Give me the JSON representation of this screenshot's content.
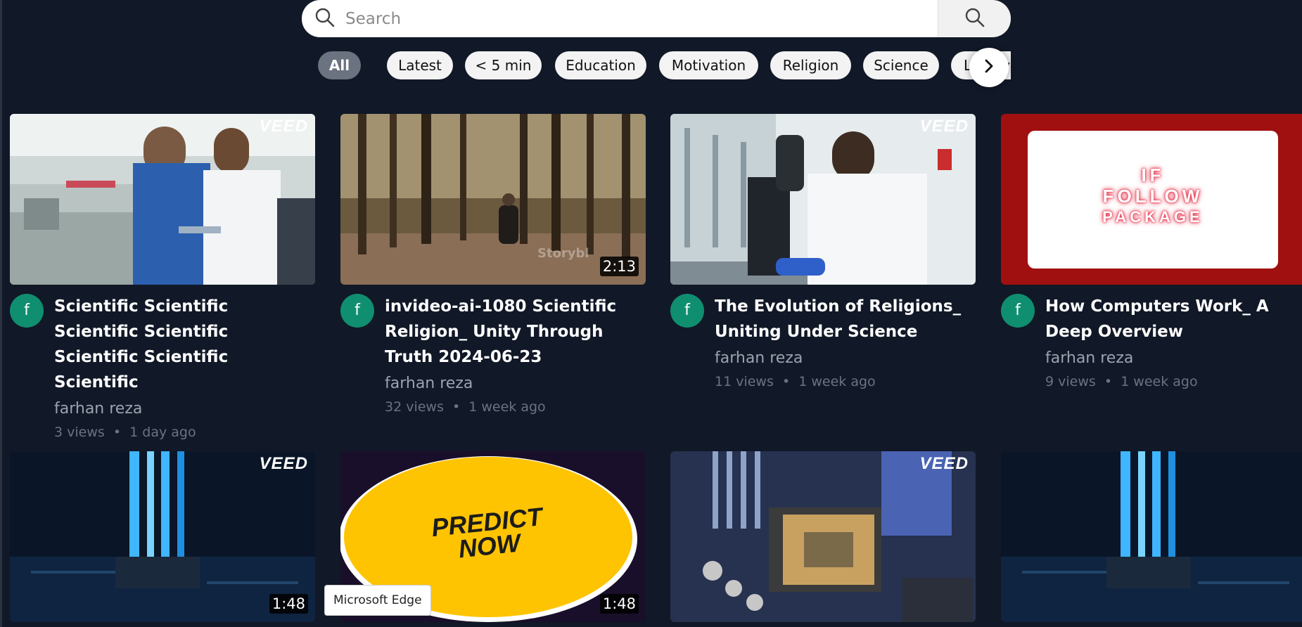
{
  "search": {
    "placeholder": "Search"
  },
  "chips": [
    "All",
    "Latest",
    "< 5 min",
    "Education",
    "Motivation",
    "Religion",
    "Science",
    "Lifesty"
  ],
  "videos": [
    {
      "title": "Scientific Scientific Scientific Scientific Scientific Scientific Scientific",
      "channel": "farhan reza",
      "views": "3 views",
      "age": "1 day ago",
      "avatar": "f",
      "watermark": "VEED",
      "duration": ""
    },
    {
      "title": "invideo-ai-1080 Scientific Religion_ Unity Through Truth 2024-06-23",
      "channel": "farhan reza",
      "views": "32 views",
      "age": "1 week ago",
      "avatar": "f",
      "watermark": "",
      "duration": "2:13"
    },
    {
      "title": "The Evolution of Religions_ Uniting Under Science",
      "channel": "farhan reza",
      "views": "11 views",
      "age": "1 week ago",
      "avatar": "f",
      "watermark": "VEED",
      "duration": ""
    },
    {
      "title": "How Computers Work_ A Deep Overview",
      "channel": "farhan reza",
      "views": "9 views",
      "age": "1 week ago",
      "avatar": "f",
      "watermark": "",
      "duration": ""
    },
    {
      "watermark": "VEED",
      "duration": "1:48"
    },
    {
      "watermark": "",
      "duration": "1:48",
      "thumb_text": "PREDICT NOW"
    },
    {
      "watermark": "VEED",
      "duration": ""
    },
    {
      "watermark": "",
      "duration": ""
    }
  ],
  "thumb_text": {
    "follow": [
      "IF",
      "FOLLOW",
      "PACKAGE"
    ],
    "storyblocks": "Storybl",
    "predict": [
      "PREDICT",
      "NOW"
    ]
  },
  "tooltip": "Microsoft Edge",
  "colors": {
    "background": "#111827",
    "avatar": "#0f8f6f",
    "chip_active": "#6b7280"
  }
}
